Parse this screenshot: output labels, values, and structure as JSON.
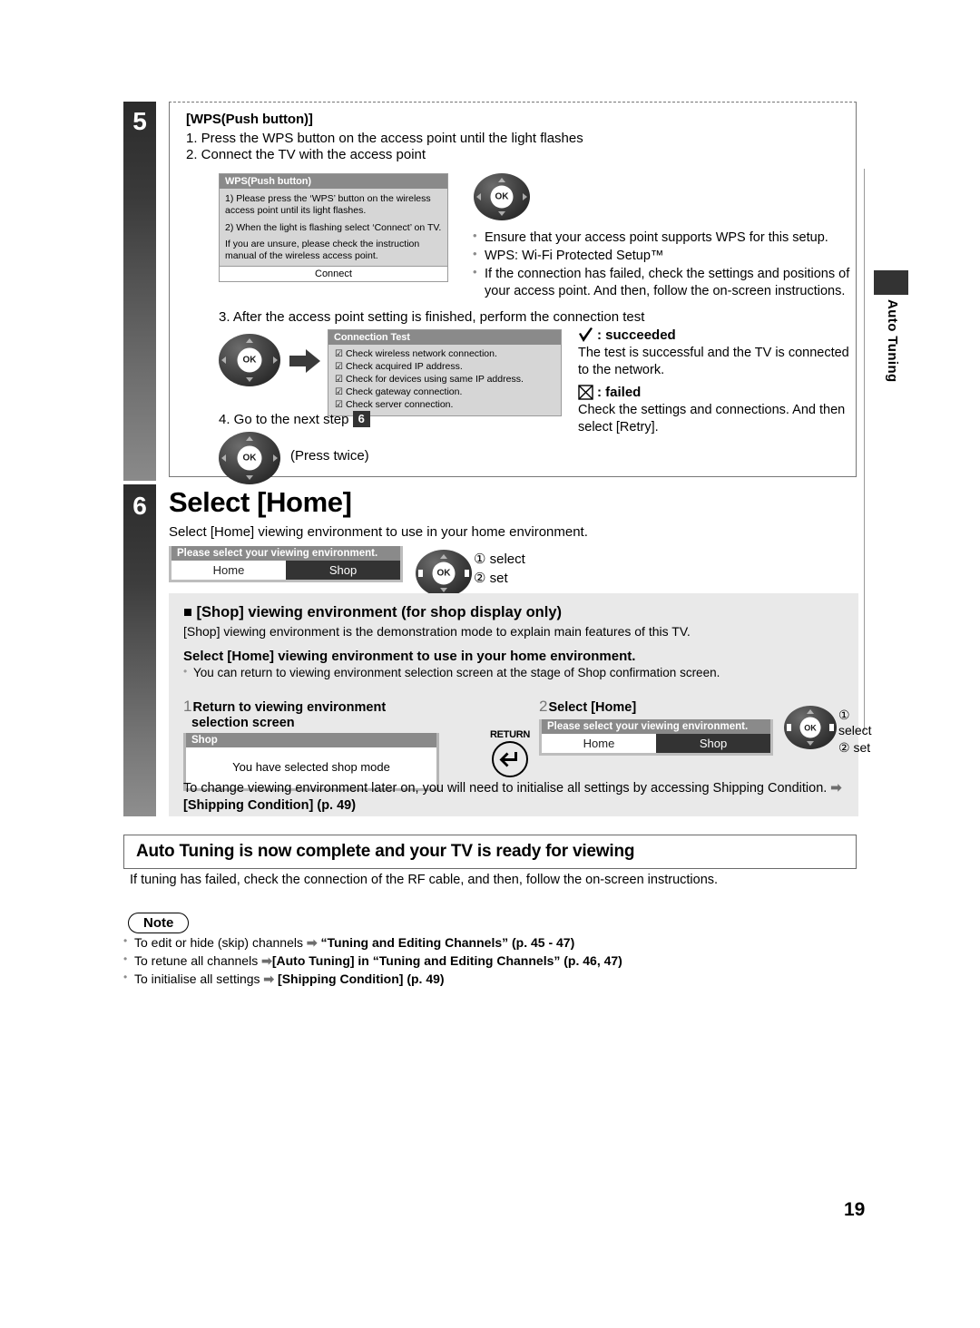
{
  "page": {
    "number": "19"
  },
  "side_tab": {
    "label": "Auto Tuning"
  },
  "step5": {
    "badge": "5",
    "heading": "[WPS(Push button)]",
    "line1": "1. Press the WPS button on the access point until the light flashes",
    "line2": "2. Connect the TV with the access point",
    "wps_panel": {
      "title": "WPS(Push button)",
      "p1": "1) Please press the ‘WPS’ button on the wireless access point until its light flashes.",
      "p2": "2) When the light is flashing select ‘Connect’ on TV.",
      "p3": "If you are unsure, please check the instruction manual of the wireless access point.",
      "button": "Connect"
    },
    "notes": [
      "Ensure that your access point supports WPS for this setup.",
      "WPS: Wi-Fi Protected Setup™",
      "If the connection has failed, check the settings and positions of your access point. And then, follow the on-screen instructions."
    ],
    "line3": "3. After the access point setting is finished, perform the connection test",
    "connection_test": {
      "title": "Connection Test",
      "items": [
        "Check wireless network connection.",
        "Check acquired IP address.",
        "Check for devices using same IP address.",
        "Check gateway connection.",
        "Check server connection."
      ]
    },
    "result": {
      "succeeded_label": ": succeeded",
      "succeeded_text": "The test is successful and the TV is connected to the network.",
      "failed_label": ": failed",
      "failed_text": "Check the settings and connections. And then select [Retry]."
    },
    "line4_pre": "4. Go to the next step",
    "line4_chip": "6",
    "press_twice": "(Press twice)",
    "ok_label": "OK"
  },
  "step6": {
    "badge": "6",
    "title": "Select [Home]",
    "subtitle": "Select [Home] viewing environment to use in your home environment.",
    "selector": {
      "header": "Please select your viewing environment.",
      "option_on": "Home",
      "option_off": "Shop"
    },
    "callout": {
      "one": "① select",
      "two": "② set"
    },
    "ok_label": "OK",
    "shop_section": {
      "heading": "■ [Shop] viewing environment (for shop display only)",
      "paragraph": "[Shop] viewing environment is the demonstration mode to explain main features of this TV.",
      "bold_line": "Select [Home] viewing environment to use in your home environment.",
      "bullet": "You can return to viewing environment selection screen at the stage of Shop confirmation screen.",
      "col1": {
        "num": "1",
        "heading_l1": "Return to viewing environment",
        "heading_l2": "selection screen",
        "panel_title": "Shop",
        "panel_body": "You have selected shop mode"
      },
      "return_icon_label": "RETURN",
      "col2": {
        "num": "2",
        "heading": "Select [Home]",
        "selector_header": "Please select your viewing environment.",
        "option_on": "Home",
        "option_off": "Shop",
        "callout_one": "① select",
        "callout_two": "② set"
      },
      "footer_text": "To change viewing environment later on, you will need to initialise all settings by accessing Shipping Condition.",
      "footer_arrow": "➡",
      "footer_bold": "[Shipping Condition] (p. 49)"
    }
  },
  "complete": {
    "banner": "Auto Tuning is now complete and your TV is ready for viewing",
    "subtext": "If tuning has failed, check the connection of the RF cable, and then, follow the on-screen instructions."
  },
  "note": {
    "label": "Note",
    "items": [
      {
        "plain": "To edit or hide (skip) channels ",
        "arrow": "➡",
        "bold": " “Tuning and Editing Channels” (p. 45 - 47)"
      },
      {
        "plain": "To retune all channels ",
        "arrow": "➡",
        "bold": "[Auto Tuning] in “Tuning and Editing Channels” (p. 46, 47)"
      },
      {
        "plain": "To initialise all settings ",
        "arrow": "➡",
        "bold": " [Shipping Condition] (p. 49)"
      }
    ]
  }
}
